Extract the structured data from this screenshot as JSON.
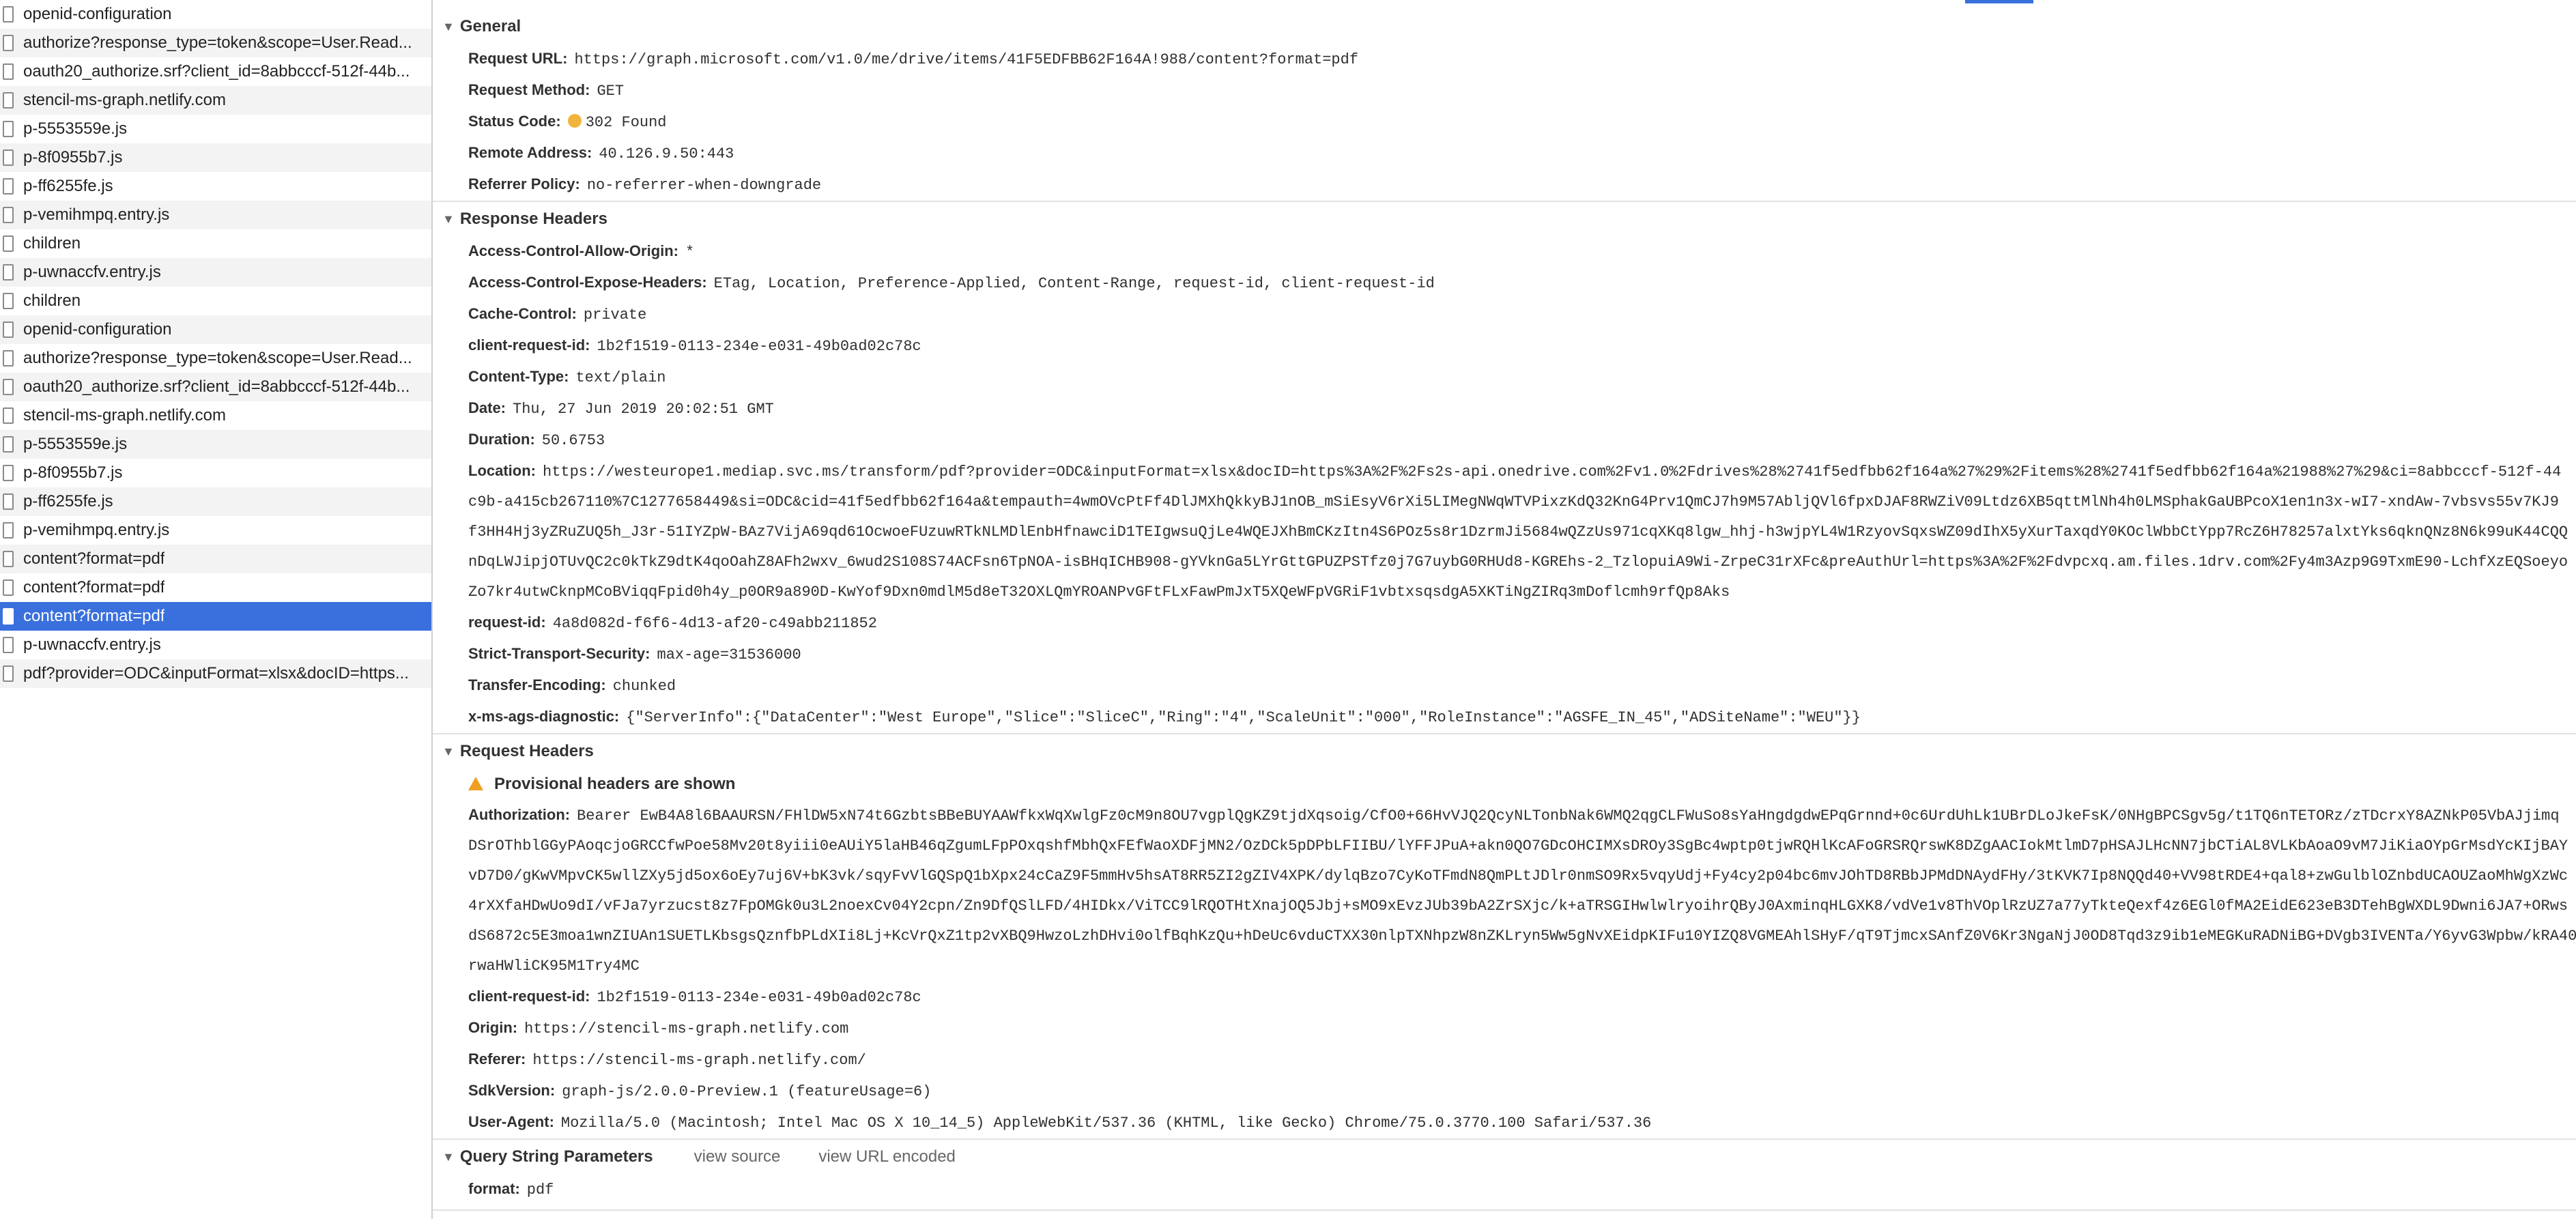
{
  "requests": [
    {
      "label": "openid-configuration"
    },
    {
      "label": "authorize?response_type=token&scope=User.Read..."
    },
    {
      "label": "oauth20_authorize.srf?client_id=8abbcccf-512f-44b..."
    },
    {
      "label": "stencil-ms-graph.netlify.com"
    },
    {
      "label": "p-5553559e.js"
    },
    {
      "label": "p-8f0955b7.js"
    },
    {
      "label": "p-ff6255fe.js"
    },
    {
      "label": "p-vemihmpq.entry.js"
    },
    {
      "label": "children"
    },
    {
      "label": "p-uwnaccfv.entry.js"
    },
    {
      "label": "children"
    },
    {
      "label": "openid-configuration"
    },
    {
      "label": "authorize?response_type=token&scope=User.Read..."
    },
    {
      "label": "oauth20_authorize.srf?client_id=8abbcccf-512f-44b..."
    },
    {
      "label": "stencil-ms-graph.netlify.com"
    },
    {
      "label": "p-5553559e.js"
    },
    {
      "label": "p-8f0955b7.js"
    },
    {
      "label": "p-ff6255fe.js"
    },
    {
      "label": "p-vemihmpq.entry.js"
    },
    {
      "label": "content?format=pdf"
    },
    {
      "label": "content?format=pdf"
    },
    {
      "label": "content?format=pdf",
      "selected": true
    },
    {
      "label": "p-uwnaccfv.entry.js"
    },
    {
      "label": "pdf?provider=ODC&inputFormat=xlsx&docID=https..."
    }
  ],
  "general": {
    "title": "General",
    "request_url_label": "Request URL:",
    "request_url": "https://graph.microsoft.com/v1.0/me/drive/items/41F5EDFBB62F164A!988/content?format=pdf",
    "request_method_label": "Request Method:",
    "request_method": "GET",
    "status_code_label": "Status Code:",
    "status_code": "302 Found",
    "remote_address_label": "Remote Address:",
    "remote_address": "40.126.9.50:443",
    "referrer_policy_label": "Referrer Policy:",
    "referrer_policy": "no-referrer-when-downgrade"
  },
  "response_headers": {
    "title": "Response Headers",
    "acao_label": "Access-Control-Allow-Origin:",
    "acao": "*",
    "aceh_label": "Access-Control-Expose-Headers:",
    "aceh": "ETag, Location, Preference-Applied, Content-Range, request-id, client-request-id",
    "cache_control_label": "Cache-Control:",
    "cache_control": "private",
    "client_request_id_label": "client-request-id:",
    "client_request_id": "1b2f1519-0113-234e-e031-49b0ad02c78c",
    "content_type_label": "Content-Type:",
    "content_type": "text/plain",
    "date_label": "Date:",
    "date": "Thu, 27 Jun 2019 20:02:51 GMT",
    "duration_label": "Duration:",
    "duration": "50.6753",
    "location_label": "Location:",
    "location_lines": [
      "https://westeurope1.mediap.svc.ms/transform/pdf?provider=ODC&inputFormat=xlsx&docID=https%3A%2F%2Fs2s-api.onedrive.com%2Fv1.0%2Fdrives%28%2741f5edfbb62f164a%27%29%2Fitems%28%2741f5edfbb62f164a%21988%27%29&ci=8abbcccf-512f-44",
      "c9b-a415cb267110%7C1277658449&si=ODC&cid=41f5edfbb62f164a&tempauth=4wmOVcPtFf4DlJMXhQkkyBJ1nOB_mSiEsyV6rXi5LIMegNWqWTVPixzKdQ32KnG4Prv1QmCJ7h9M57AbljQVl6fpxDJAF8RWZiV09Ltdz6XB5qttMlNh4h0LMSphakGaUBPcoX1en1n3x-wI7-xndAw-7vbsvs55v7KJ9",
      "f3HH4Hj3yZRuZUQ5h_J3r-51IYZpW-BAz7VijA69qd61OcwoeFUzuwRTkNLMDlEnbHfnawciD1TEIgwsuQjLe4WQEJXhBmCKzItn4S6POz5s8r1DzrmJi5684wQZzUs971cqXKq8lgw_hhj-h3wjpYL4W1RzyovSqxsWZ09dIhX5yXurTaxqdY0KOclWbbCtYpp7RcZ6H78257alxtYks6qknQNz8N6k99uK44CQQ",
      "nDqLWJipjOTUvQC2c0kTkZ9dtK4qoOahZ8AFh2wxv_6wud2S108S74ACFsn6TpNOA-isBHqICHB908-gYVknGa5LYrGttGPUZPSTfz0j7G7uybG0RHUd8-KGREhs-2_TzlopuiA9Wi-ZrpeC31rXFc&preAuthUrl=https%3A%2F%2Fdvpcxq.am.files.1drv.com%2Fy4m3Azp9G9TxmE90-LchfXzEQSoeyo",
      "Zo7kr4utwCknpMCoBViqqFpid0h4y_p0OR9a890D-KwYof9Dxn0mdlM5d8eT32OXLQmYROANPvGFtFLxFawPmJxT5XQeWFpVGRiF1vbtxsqsdgA5XKTiNgZIRq3mDoflcmh9rfQp8Aks"
    ],
    "request_id_label": "request-id:",
    "request_id": "4a8d082d-f6f6-4d13-af20-c49abb211852",
    "sts_label": "Strict-Transport-Security:",
    "sts": "max-age=31536000",
    "transfer_encoding_label": "Transfer-Encoding:",
    "transfer_encoding": "chunked",
    "x_ms_label": "x-ms-ags-diagnostic:",
    "x_ms": "{\"ServerInfo\":{\"DataCenter\":\"West Europe\",\"Slice\":\"SliceC\",\"Ring\":\"4\",\"ScaleUnit\":\"000\",\"RoleInstance\":\"AGSFE_IN_45\",\"ADSiteName\":\"WEU\"}}"
  },
  "request_headers": {
    "title": "Request Headers",
    "provisional_warning": "Provisional headers are shown",
    "authorization_label": "Authorization:",
    "authorization_lines": [
      "Bearer EwB4A8l6BAAURSN/FHlDW5xN74t6GzbtsBBeBUYAAWfkxWqXwlgFz0cM9n8OU7vgplQgKZ9tjdXqsoig/CfO0+66HvVJQ2QcyNLTonbNak6WMQ2qgCLFWuSo8sYaHngdgdwEPqGrnnd+0c6UrdUhLk1UBrDLoJkeFsK/0NHgBPCSgv5g/t1TQ6nTETORz/zTDcrxY8AZNkP05VbAJjimq",
      "DSrOThblGGyPAoqcjoGRCCfwPoe58Mv20t8yiii0eAUiY5laHB46qZgumLFpPOxqshfMbhQxFEfWaoXDFjMN2/OzDCk5pDPbLFIIBU/lYFFJPuA+akn0QO7GDcOHCIMXsDROy3SgBc4wptp0tjwRQHlKcAFoGRSRQrswK8DZgAACIokMtlmD7pHSAJLHcNN7jbCTiAL8VLKbAoaO9vM7JiKiaOYpGrMsdYcKIjBAY",
      "vD7D0/gKwVMpvCK5wllZXy5jd5ox6oEy7uj6V+bK3vk/sqyFvVlGQSpQ1bXpx24cCaZ9F5mmHv5hsAT8RR5ZI2gZIV4XPK/dylqBzo7CyKoTFmdN8QmPLtJDlr0nmSO9Rx5vqyUdj+Fy4cy2p04bc6mvJOhTD8RBbJPMdDNAydFHy/3tKVK7Ip8NQQd40+VV98tRDE4+qal8+zwGulblOZnbdUCAOUZaoMhWgXzWc",
      "4rXXfaHDwUo9dI/vFJa7yrzucst8z7FpOMGk0u3L2noexCv04Y2cpn/Zn9DfQSlLFD/4HIDkx/ViTCC9lRQOTHtXnajOQ5Jbj+sMO9xEvzJUb39bA2ZrSXjc/k+aTRSGIHwlwlryoihrQByJ0AxminqHLGXK8/vdVe1v8ThVOplRzUZ7a77yTkteQexf4z6EGl0fMA2EidE623eB3DTehBgWXDL9Dwni6JA7+ORws",
      "dS6872c5E3moa1wnZIUAn1SUETLKbsgsQznfbPLdXIi8Lj+KcVrQxZ1tp2vXBQ9HwzoLzhDHvi0olfBqhKzQu+hDeUc6vduCTXX30nlpTXNhpzW8nZKLryn5Ww5gNvXEidpKIFu10YIZQ8VGMEAhlSHyF/qT9TjmcxSAnfZ0V6Kr3NgaNjJ0OD8Tqd3z9ib1eMEGKuRADNiBG+DVgb3IVENTa/Y6yvG3Wpbw/kRA40",
      "rwaHWliCK95M1Try4MC"
    ],
    "client_request_id_label": "client-request-id:",
    "client_request_id": "1b2f1519-0113-234e-e031-49b0ad02c78c",
    "origin_label": "Origin:",
    "origin": "https://stencil-ms-graph.netlify.com",
    "referer_label": "Referer:",
    "referer": "https://stencil-ms-graph.netlify.com/",
    "sdk_version_label": "SdkVersion:",
    "sdk_version": "graph-js/2.0.0-Preview.1 (featureUsage=6)",
    "user_agent_label": "User-Agent:",
    "user_agent": "Mozilla/5.0 (Macintosh; Intel Mac OS X 10_14_5) AppleWebKit/537.36 (KHTML, like Gecko) Chrome/75.0.3770.100 Safari/537.36"
  },
  "query_string": {
    "title": "Query String Parameters",
    "view_source": "view source",
    "view_url_encoded": "view URL encoded",
    "format_label": "format:",
    "format": "pdf"
  },
  "colors": {
    "selected_row": "#3a70dd",
    "status_dot": "#f0b43c",
    "warning": "#f0a020"
  }
}
